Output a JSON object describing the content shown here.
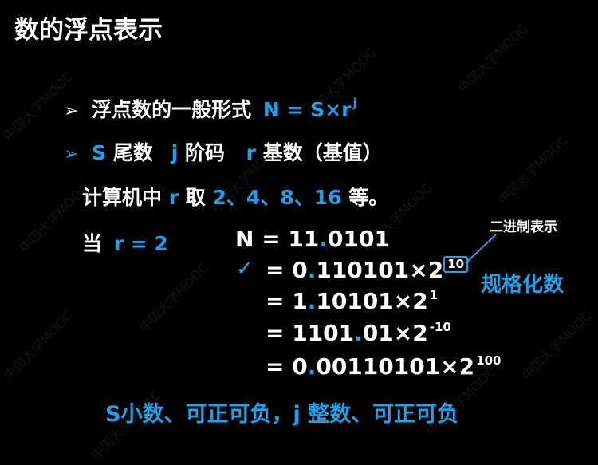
{
  "title": "数的浮点表示",
  "watermark": "中国大学MOOC",
  "bullet1": {
    "label": "浮点数的一般形式",
    "formula": "N = S×r",
    "exp": "j"
  },
  "bullet2": {
    "s": "S",
    "s_label": "尾数",
    "j": "j",
    "j_label": "阶码",
    "r": "r",
    "r_label": "基数（基值）"
  },
  "line3": {
    "prefix": "计算机中",
    "r": "r",
    "mid": "取",
    "values": "2、4、8、16",
    "suffix": "等。"
  },
  "case_label": {
    "when": "当",
    "cond": "r = 2"
  },
  "equations": [
    {
      "lhs": "N",
      "eq": "=",
      "int": "11",
      "dot": ".",
      "frac": "0101",
      "times": "",
      "exp": ""
    },
    {
      "lhs": "",
      "eq": "=",
      "int": "0",
      "dot": ".",
      "frac": "110101",
      "times": "×2",
      "exp": "10"
    },
    {
      "lhs": "",
      "eq": "=",
      "int": "1",
      "dot": ".",
      "frac": "10101",
      "times": "×2",
      "exp": "1"
    },
    {
      "lhs": "",
      "eq": "=",
      "int": "1101",
      "dot": ".",
      "frac": "01",
      "times": "×2",
      "exp": "-10"
    },
    {
      "lhs": "",
      "eq": "=",
      "int": "0",
      "dot": ".",
      "frac": "00110101",
      "times": "×2",
      "exp": "100"
    }
  ],
  "check_mark": "✓",
  "annotation_binary": "二进制表示",
  "annotation_normalized": "规格化数",
  "bottom_text": "S小数、可正可负，j 整数、可正可负",
  "colors": {
    "accent": "#1fa0e8",
    "background": "#000000",
    "text": "#ffffff"
  }
}
